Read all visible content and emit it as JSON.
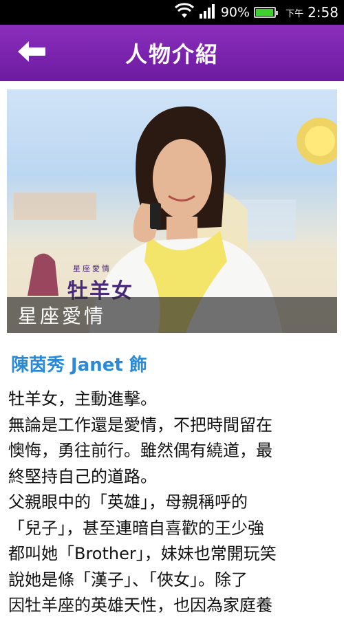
{
  "status_bar": {
    "battery": "90%",
    "ampm": "下午",
    "time": "2:58",
    "icons": [
      "wifi-icon",
      "signal-icon",
      "battery-icon"
    ],
    "battery_color": "#3fcf2f",
    "battery_level": 0.9
  },
  "app_bar": {
    "title": "人物介紹",
    "back_icon": "arrow-left-icon",
    "color": "#7a22ad"
  },
  "hero": {
    "caption": "星座愛情",
    "logo_small": "星座愛情",
    "logo_big": "牡羊女"
  },
  "cast": {
    "name": "陳茵秀 Janet 飾",
    "name_color": "#2a8ad8"
  },
  "description_lines": [
    "牡羊女，主動進擊。",
    "無論是工作還是愛情，不把時間留在",
    "懊悔，勇往前行。雖然偶有繞道，最",
    "終堅持自己的道路。",
    "父親眼中的「英雄」，母親稱呼的",
    "「兒子」，甚至連暗自喜歡的王少強",
    "都叫她「Brother」，妹妹也常開玩笑",
    "說她是條「漢子」、「俠女」。除了",
    "因牡羊座的英雄天性，也因為家庭養"
  ]
}
